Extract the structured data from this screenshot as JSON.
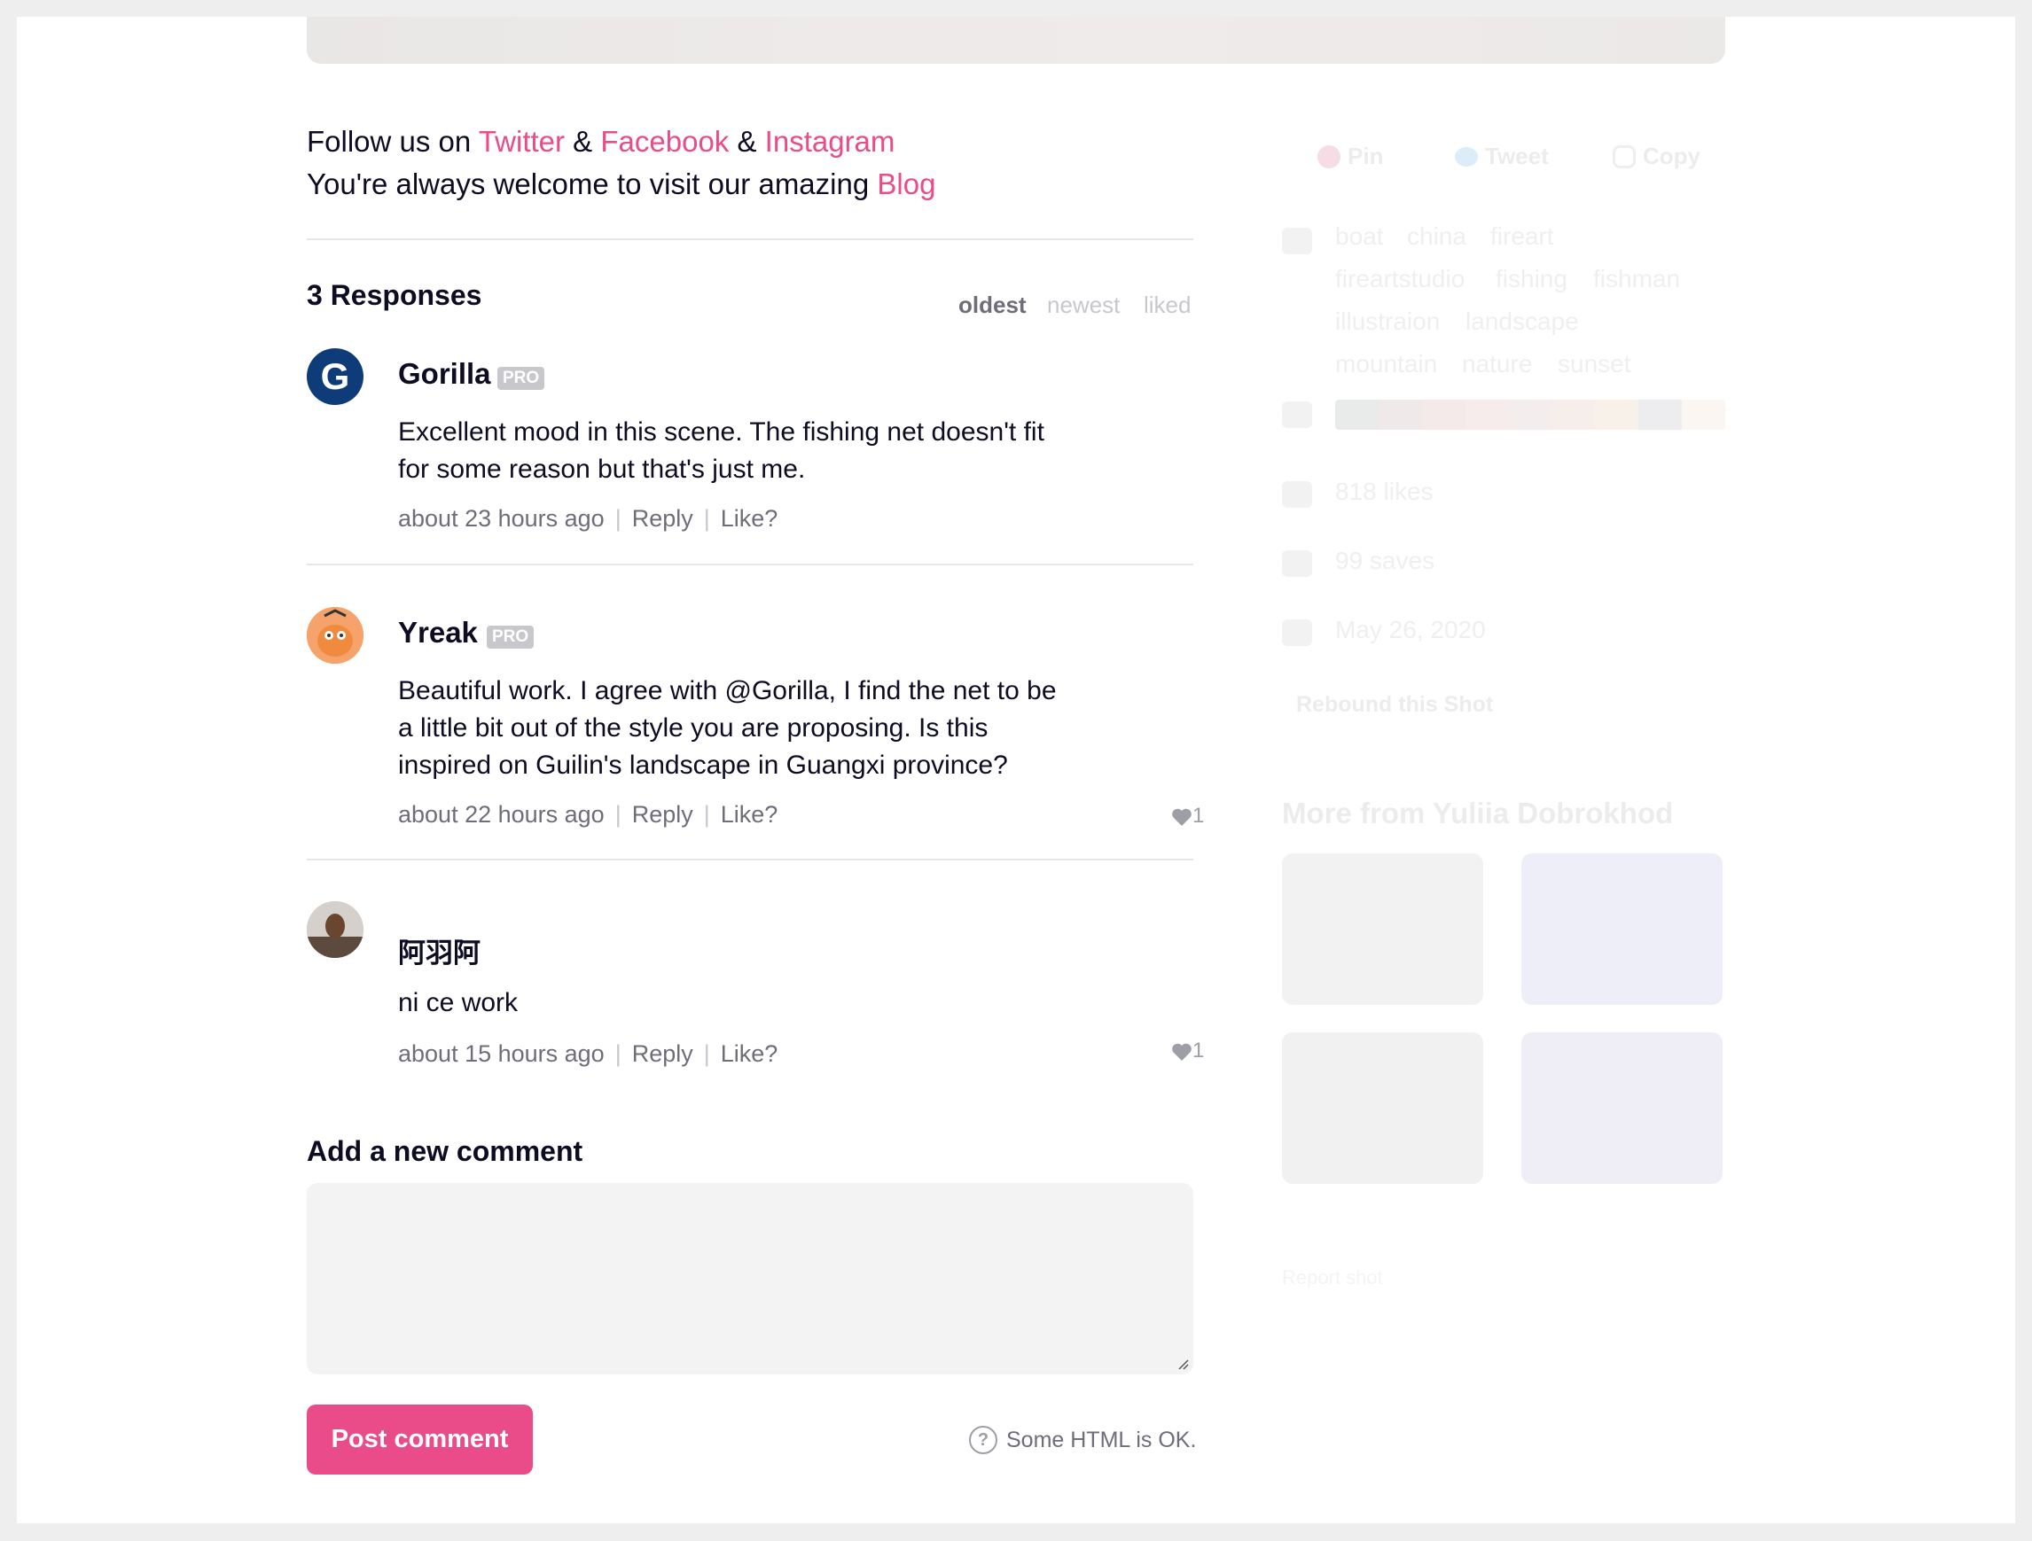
{
  "follow": {
    "prefix": "Follow us on ",
    "twitter": "Twitter",
    "amp1": " & ",
    "facebook": "Facebook",
    "amp2": " & ",
    "instagram": "Instagram",
    "blog_prefix": "You're always welcome to visit our amazing ",
    "blog": "Blog"
  },
  "responses": {
    "title": "3 Responses",
    "sort": [
      "oldest",
      "newest",
      "liked"
    ],
    "active_sort": "oldest"
  },
  "comments": [
    {
      "name": "Gorilla",
      "badge": "PRO",
      "avatar_letter": "G",
      "body_lines": [
        "Excellent mood in this scene. The fishing net doesn't fit",
        "for some reason but that's just me."
      ],
      "time": "about 23 hours ago",
      "reply": "Reply",
      "like": "Like?",
      "likes": ""
    },
    {
      "name": "Yreak",
      "badge": "PRO",
      "body_lines": [
        "Beautiful work. I agree with @Gorilla, I find the net to be",
        "a little bit out of the style you are proposing. Is this",
        "inspired on Guilin's landscape in Guangxi province?"
      ],
      "time": "about 22 hours ago",
      "reply": "Reply",
      "like": "Like?",
      "likes": "1"
    },
    {
      "name": "阿羽阿",
      "badge": "",
      "body_lines": [
        "ni ce work"
      ],
      "time": "about 15 hours ago",
      "reply": "Reply",
      "like": "Like?",
      "likes": "1"
    }
  ],
  "new_comment": {
    "title": "Add a new comment",
    "textarea_value": "",
    "post_label": "Post comment",
    "html_note": "Some HTML is OK."
  },
  "sidebar": {
    "share": [
      "Pin",
      "Tweet",
      "Copy"
    ],
    "tags": [
      "boat",
      "china",
      "fireart",
      "fireartstudio",
      "fishing",
      "fishman",
      "illustraion",
      "landscape",
      "mountain",
      "nature",
      "sunset"
    ],
    "palette": [
      "#e9ebea",
      "#efe9e9",
      "#f4eaea",
      "#f6eceb",
      "#f3eded",
      "#f6eeea",
      "#f8f1ea",
      "#ededef",
      "#fbf6f1"
    ],
    "likes": "818 likes",
    "saves": "99 saves",
    "date": "May 26, 2020",
    "rebound": "Rebound this Shot",
    "more_title": "More from Yuliia Dobrokhod",
    "report": "Report shot"
  },
  "colors": {
    "accent": "#ea4c89",
    "text": "#0d0c22",
    "muted": "#6e6d7a"
  }
}
